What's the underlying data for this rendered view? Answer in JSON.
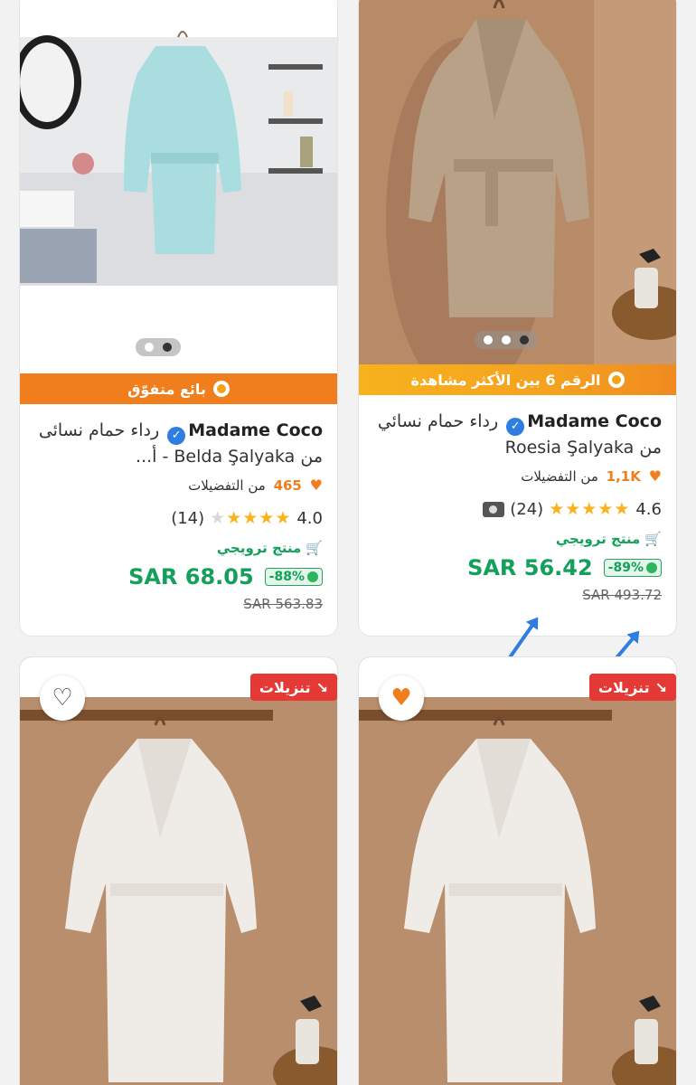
{
  "products": [
    {
      "brand": "Madame Coco",
      "title_ar": "رداء حمام نسائي من Roesia Şalyaka",
      "banner": "الرقم 6 بين الأكثر مشاهدة",
      "favorites_count": "1,1K",
      "favorites_label": "من التفضيلات",
      "rating": "4.6",
      "reviews": "(24)",
      "local_label": "منتج ترويجي",
      "discount": "-89%",
      "price": "SAR 56.42",
      "old_price": "SAR 493.72",
      "stars_filled": 5,
      "icons": [
        "heart-icon",
        "camera-icon",
        "cart-icon",
        "verified-icon"
      ]
    },
    {
      "brand": "Madame Coco",
      "title_ar": "رداء حمام نسائى من Belda Şalyaka - أ...",
      "banner": "بائع متفوّق",
      "favorites_count": "465",
      "favorites_label": "من التفضيلات",
      "rating": "4.0",
      "reviews": "(14)",
      "local_label": "منتج ترويجي",
      "discount": "-88%",
      "price": "SAR 68.05",
      "old_price": "SAR 563.83",
      "stars_filled": 4,
      "icons": [
        "heart-icon",
        "cart-icon",
        "verified-icon"
      ]
    }
  ],
  "bottom_cards": [
    {
      "sale_label": "تنزيلات",
      "wishlist": "filled"
    },
    {
      "sale_label": "تنزيلات",
      "wishlist": "empty"
    }
  ],
  "colors": {
    "accent_orange": "#f07e1c",
    "price_green": "#12a05a",
    "sale_red": "#e53935",
    "annotation_blue": "#2f7de1"
  }
}
